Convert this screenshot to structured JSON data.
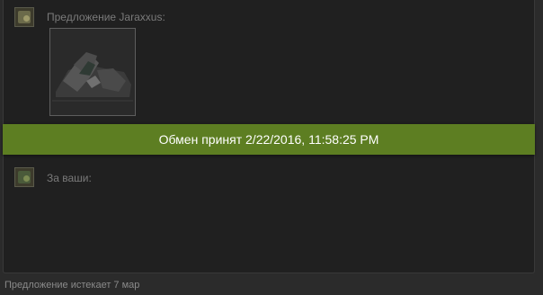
{
  "offer": {
    "from_label": "Предложение Jaraxxus:",
    "your_label": "За ваши:"
  },
  "banner": {
    "status_text": "Обмен принят 2/22/2016, 11:58:25 PM",
    "accent_color": "#5d7e22"
  },
  "footer": {
    "expiry_text": "Предложение истекает 7 мар"
  },
  "icons": [
    "user-avatar-icon",
    "item-image-icon"
  ]
}
